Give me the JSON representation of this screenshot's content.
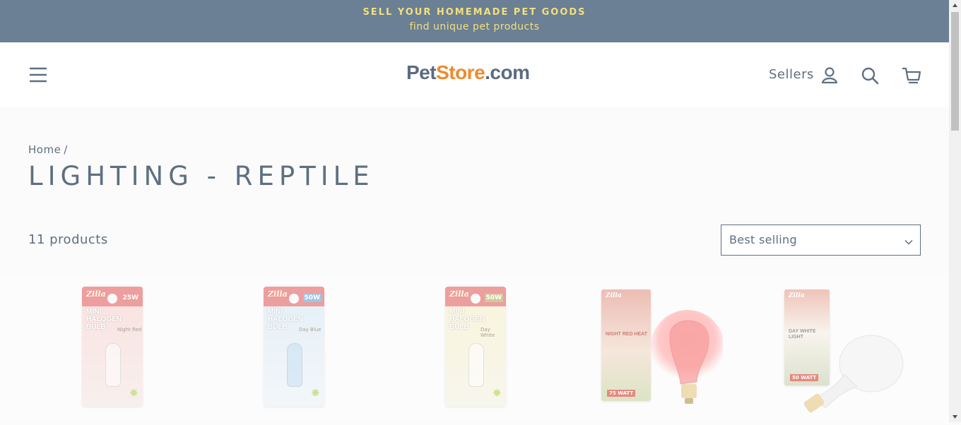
{
  "announcement": {
    "line1": "SELL YOUR HOMEMADE PET GOODS",
    "line2": "find unique pet products",
    "text_color": "#f3e07a",
    "background": "#6b7f95"
  },
  "header": {
    "logo": {
      "pet": "Pet",
      "store": "Store",
      "com": ".com",
      "brand_color": "#ef8a2d"
    },
    "sellers_label": "Sellers",
    "icons": {
      "menu": "hamburger-menu-icon",
      "account": "user-icon",
      "search": "search-icon",
      "cart": "cart-icon"
    }
  },
  "breadcrumb": {
    "home": "Home",
    "separator": "/"
  },
  "collection": {
    "title": "LIGHTING - REPTILE",
    "product_count": "11 products",
    "sort": {
      "selected": "Best selling",
      "icon": "chevron-down-icon"
    }
  },
  "products": [
    {
      "brand": "Zilla",
      "title_line1": "MINI",
      "title_line2": "HALOGEN BULB",
      "wattage": "25W",
      "variant": "Night Red",
      "color": "#e46a6a"
    },
    {
      "brand": "Zilla",
      "title_line1": "MINI",
      "title_line2": "HALOGEN BULB",
      "wattage": "50W",
      "variant": "Day Blue",
      "color": "#6aa8d8"
    },
    {
      "brand": "Zilla",
      "title_line1": "MINI",
      "title_line2": "HALOGEN BULB",
      "wattage": "50W",
      "variant": "Day White",
      "color": "#ead77a"
    },
    {
      "brand": "Zilla",
      "title": "NIGHT RED HEAT",
      "wattage": "75 WATT",
      "color": "#d94a3c"
    },
    {
      "brand": "Zilla",
      "title": "DAY WHITE LIGHT",
      "wattage": "50 WATT",
      "color": "#d94a3c"
    }
  ]
}
